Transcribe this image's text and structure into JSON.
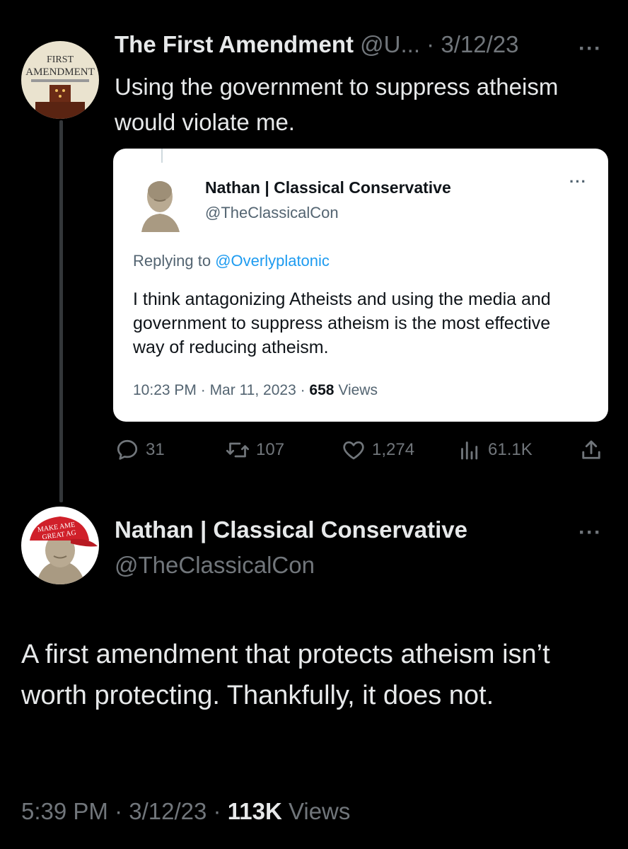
{
  "tweet1": {
    "avatar_label_top": "FIRST",
    "avatar_label_bottom": "AMENDMENT",
    "name": "The First Amendment",
    "handle": "@U...",
    "date": "3/12/23",
    "more": "···",
    "text": "Using the government to suppress atheism would violate me.",
    "quote": {
      "name": "Nathan | Classical Conservative",
      "handle": "@TheClassicalCon",
      "more": "···",
      "replying_label": "Replying to ",
      "replying_handle": "@Overlyplatonic",
      "text": "I think antagonizing Atheists and using the media and government to suppress atheism is the most effective way of reducing atheism.",
      "time": "10:23 PM",
      "date": "Mar 11, 2023",
      "views_count": "658",
      "views_label": "Views"
    },
    "actions": {
      "replies": "31",
      "retweets": "107",
      "likes": "1,274",
      "views": "61.1K"
    }
  },
  "tweet2": {
    "avatar_hat_text_1": "MAKE AME",
    "avatar_hat_text_2": "GREAT AG",
    "name": "Nathan | Classical Conservative",
    "handle": "@TheClassicalCon",
    "more": "···",
    "text": "A first amendment that protects atheism isn’t worth protecting. Thankfully, it does not.",
    "time": "5:39 PM",
    "date": "3/12/23",
    "views_count": "113K",
    "views_label": "Views"
  },
  "colors": {
    "background": "#000000",
    "primary_text": "#e7e9ea",
    "secondary_text": "#71767b",
    "link": "#1d9bf0",
    "hat_red": "#d0202a"
  }
}
